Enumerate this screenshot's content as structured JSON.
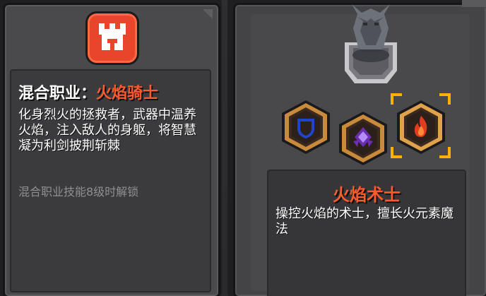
{
  "hybrid_class": {
    "title_prefix": "混合职业：",
    "title_name": "火焰骑士",
    "description": "化身烈火的拯救者，武器中温养火焰，注入敌人的身躯，将智慧凝为利剑披荆斩棘",
    "unlock_note": "混合职业技能8级时解锁",
    "badge_icon": "castle-icon",
    "badge_color": "#e8452a"
  },
  "specialization": {
    "name": "火焰术士",
    "description": "操控火焰的术士，擅长火元素魔法",
    "name_color": "#ff5a2d"
  },
  "class_options": [
    {
      "icon": "shield-icon",
      "selected": false
    },
    {
      "icon": "rune-icon",
      "selected": false
    },
    {
      "icon": "fire-icon",
      "selected": true
    }
  ],
  "pedestal": {
    "icon": "gargoyle-statue-icon"
  },
  "colors": {
    "hex_border": "#c98a3a",
    "selection": "#ffb000"
  }
}
